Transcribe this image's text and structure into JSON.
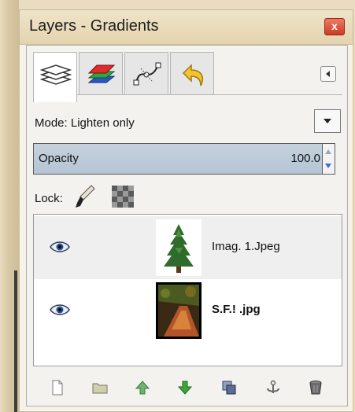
{
  "window": {
    "title": "Layers - Gradients",
    "close_label": "x"
  },
  "tabs": [
    {
      "name": "layers-tab",
      "icon": "layers-icon",
      "active": true
    },
    {
      "name": "channels-tab",
      "icon": "channels-icon",
      "active": false
    },
    {
      "name": "paths-tab",
      "icon": "paths-icon",
      "active": false
    },
    {
      "name": "undo-history-tab",
      "icon": "undo-history-icon",
      "active": false
    }
  ],
  "mode": {
    "label": "Mode: Lighten only"
  },
  "opacity": {
    "label": "Opacity",
    "value": "100.0"
  },
  "lock": {
    "label": "Lock:"
  },
  "layers": [
    {
      "name": "Imag. 1.Jpeg",
      "visible": true,
      "selected": true,
      "thumbnail": "tree-thumbnail"
    },
    {
      "name": "S.F.!  .jpg",
      "visible": true,
      "selected": false,
      "thumbnail": "autumn-path-thumbnail"
    }
  ],
  "toolbar": {
    "buttons": [
      "new-layer-icon",
      "new-layer-group-icon",
      "raise-layer-icon",
      "lower-layer-icon",
      "duplicate-layer-icon",
      "anchor-layer-icon",
      "delete-layer-icon"
    ]
  },
  "colors": {
    "title_bar": "#e4d4ae",
    "opacity_fill": "#b5c5d4",
    "close_button": "#c93b24",
    "raise_arrow": "#5fa35f",
    "lower_arrow": "#3ca53c"
  }
}
